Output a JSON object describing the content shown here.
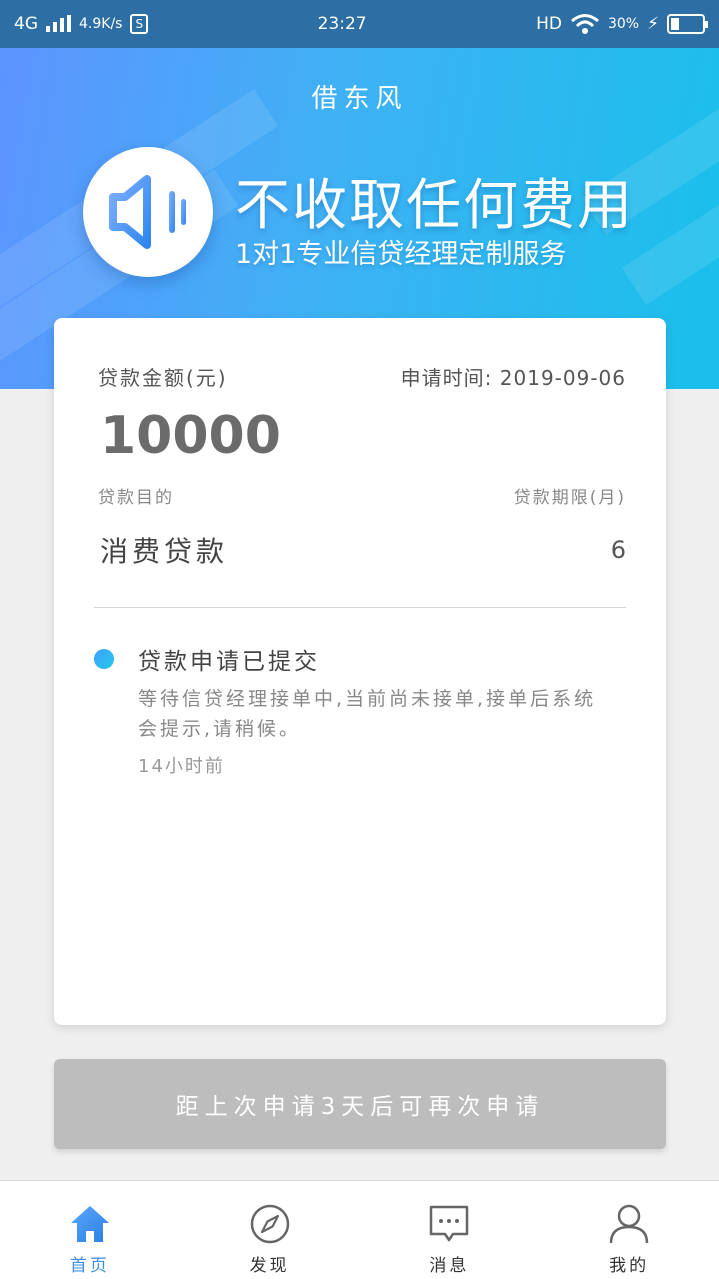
{
  "status_bar": {
    "network": "4G",
    "speed": "4.9K/s",
    "sim_badge": "S",
    "time": "23:27",
    "hd": "HD",
    "battery": "30%"
  },
  "header": {
    "app_title": "借东风",
    "heading": "不收取任何费用",
    "subheading": "1对1专业信贷经理定制服务"
  },
  "card": {
    "amount_label": "贷款金额(元)",
    "apply_time_label": "申请时间:",
    "apply_time": "2019-09-06",
    "amount": "10000",
    "purpose_label": "贷款目的",
    "term_label": "贷款期限(月)",
    "purpose": "消费贷款",
    "term": "6",
    "status": {
      "title": "贷款申请已提交",
      "description": "等待信贷经理接单中,当前尚未接单,接单后系统会提示,请稍候。",
      "time": "14小时前"
    }
  },
  "reapply_button": "距上次申请3天后可再次申请",
  "tabbar": {
    "items": [
      {
        "label": "首页",
        "icon": "home-icon",
        "active": true
      },
      {
        "label": "发现",
        "icon": "compass-icon"
      },
      {
        "label": "消息",
        "icon": "message-icon"
      },
      {
        "label": "我的",
        "icon": "user-icon"
      }
    ]
  },
  "colors": {
    "accent": "#3f8fe8",
    "hero_start": "#5e93ff",
    "hero_end": "#19c0ea",
    "disabled_button": "#bdbdbd"
  }
}
